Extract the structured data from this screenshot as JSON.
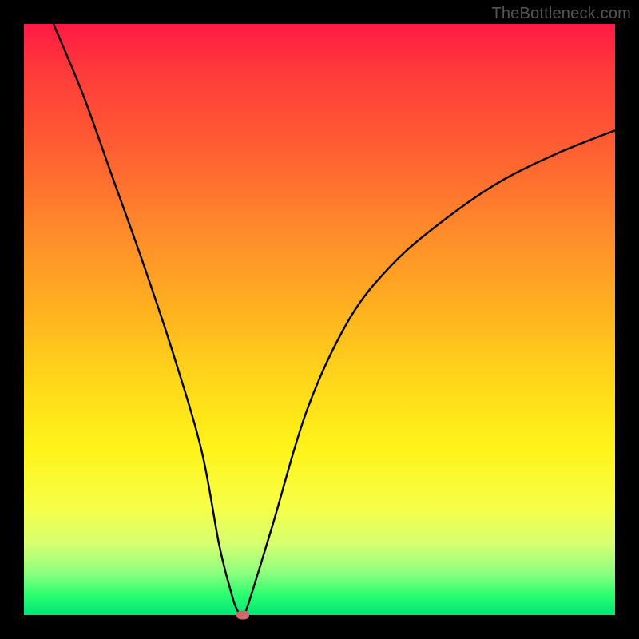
{
  "watermark": "TheBottleneck.com",
  "chart_data": {
    "type": "line",
    "title": "",
    "xlabel": "",
    "ylabel": "",
    "xlim": [
      0,
      100
    ],
    "ylim": [
      0,
      100
    ],
    "grid": false,
    "legend": false,
    "series": [
      {
        "name": "curve",
        "x": [
          5,
          10,
          15,
          20,
          25,
          30,
          33,
          35,
          36,
          37,
          38,
          42,
          48,
          55,
          62,
          70,
          80,
          90,
          100
        ],
        "y": [
          100,
          88,
          74,
          60,
          45,
          28,
          12,
          4,
          1,
          0,
          2,
          15,
          35,
          50,
          59,
          66,
          73,
          78,
          82
        ]
      }
    ],
    "marker": {
      "x": 37,
      "y": 0
    },
    "background": "gradient-red-green"
  }
}
